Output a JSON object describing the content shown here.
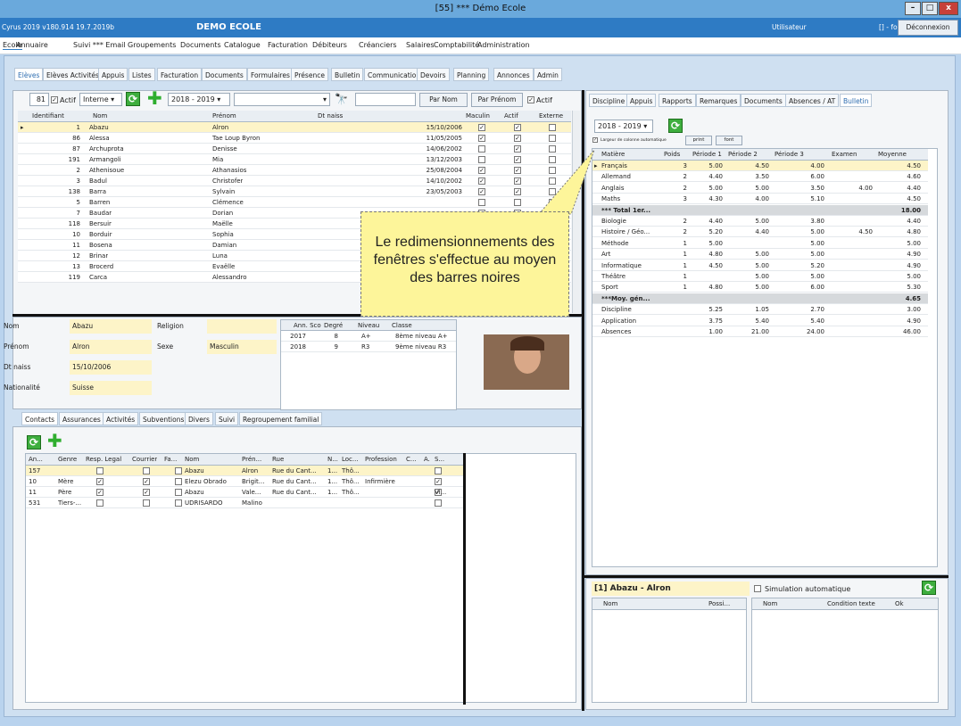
{
  "window": {
    "title": "[55] *** Démo Ecole",
    "min": "–",
    "max": "□",
    "close": "x"
  },
  "appbar": {
    "version": "Cyrus 2019 v180.914 19.7.2019b",
    "school": "DEMO ECOLE",
    "user_label": "Utilisateur",
    "user": "[] - fo",
    "logout": "Déconnexion"
  },
  "menu": [
    "Ecole",
    "Annuaire",
    "Suivi *** Email",
    "Groupements",
    "Documents",
    "Catalogue",
    "Facturation",
    "Débiteurs",
    "Créanciers",
    "Salaires",
    "Comptabilité",
    "Administration"
  ],
  "subtabs": [
    "Elèves",
    "Elèves Activités",
    "Appuis",
    "Listes",
    "Facturation",
    "Documents",
    "Formulaires",
    "Présence",
    "Bulletin",
    "Communication",
    "Devoirs",
    "Planning",
    "Annonces",
    "Admin"
  ],
  "filter": {
    "count": "81",
    "actif_label": "Actif",
    "type": "Interne",
    "year": "2018 - 2019",
    "by_name": "Par Nom",
    "by_firstname": "Par Prénom",
    "actif2": "Actif"
  },
  "students": {
    "columns": [
      "Identifiant",
      "Nom",
      "Prénom",
      "Dt naiss",
      "Maculin",
      "Actif",
      "Externe"
    ],
    "rows": [
      {
        "id": "1",
        "nom": "Abazu",
        "prenom": "Alron",
        "dt": "15/10/2006",
        "m": true,
        "a": true
      },
      {
        "id": "86",
        "nom": "Alessa",
        "prenom": "Tae Loup Byron",
        "dt": "11/05/2005",
        "m": true,
        "a": true
      },
      {
        "id": "87",
        "nom": "Archuprota",
        "prenom": "Denisse",
        "dt": "14/06/2002",
        "m": false,
        "a": true
      },
      {
        "id": "191",
        "nom": "Armangoli",
        "prenom": "Mia",
        "dt": "13/12/2003",
        "m": false,
        "a": true
      },
      {
        "id": "2",
        "nom": "Athenisoue",
        "prenom": "Athanasios",
        "dt": "25/08/2004",
        "m": true,
        "a": true
      },
      {
        "id": "3",
        "nom": "Badul",
        "prenom": "Christofer",
        "dt": "14/10/2002",
        "m": true,
        "a": true
      },
      {
        "id": "138",
        "nom": "Barra",
        "prenom": "Sylvain",
        "dt": "23/05/2003",
        "m": true,
        "a": true
      },
      {
        "id": "5",
        "nom": "Barren",
        "prenom": "Clémence",
        "dt": "",
        "m": false,
        "a": false
      },
      {
        "id": "7",
        "nom": "Baudar",
        "prenom": "Dorian",
        "dt": "",
        "m": false,
        "a": false
      },
      {
        "id": "118",
        "nom": "Bersuir",
        "prenom": "Maëlle",
        "dt": "",
        "m": false,
        "a": false
      },
      {
        "id": "10",
        "nom": "Borduir",
        "prenom": "Sophia",
        "dt": "",
        "m": false,
        "a": false
      },
      {
        "id": "11",
        "nom": "Bosena",
        "prenom": "Damian",
        "dt": "",
        "m": false,
        "a": false
      },
      {
        "id": "12",
        "nom": "Brinar",
        "prenom": "Luna",
        "dt": "",
        "m": false,
        "a": false
      },
      {
        "id": "13",
        "nom": "Brocerd",
        "prenom": "Evaëlle",
        "dt": "",
        "m": false,
        "a": false
      },
      {
        "id": "119",
        "nom": "Carca",
        "prenom": "Alessandro",
        "dt": "",
        "m": false,
        "a": false
      }
    ]
  },
  "detail": {
    "nom_l": "Nom",
    "nom": "Abazu",
    "religion_l": "Religion",
    "prenom_l": "Prénom",
    "prenom": "Alron",
    "sexe_l": "Sexe",
    "sexe": "Masculin",
    "dt_l": "Dt naiss",
    "dt": "15/10/2006",
    "nat_l": "Nationalité",
    "nat": "Suisse"
  },
  "years": {
    "columns": [
      "Ann. Sco",
      "Degré",
      "Niveau",
      "Classe"
    ],
    "rows": [
      [
        "2017",
        "8",
        "A+",
        "8ème niveau A+"
      ],
      [
        "2018",
        "9",
        "R3",
        "9ème niveau R3"
      ]
    ]
  },
  "bottomtabs": [
    "Contacts",
    "Assurances",
    "Activités",
    "Subventions",
    "Divers",
    "Suivi",
    "Regroupement familial"
  ],
  "contacts": {
    "columns": [
      "An...",
      "Genre",
      "Resp. Legal",
      "Courrier",
      "Fa...",
      "Nom",
      "Prén...",
      "Rue",
      "N...",
      "Loc...",
      "Profession",
      "C...",
      "A.",
      "S..."
    ],
    "rows": [
      [
        "157",
        "",
        "",
        "",
        "",
        "Abazu",
        "Alron",
        "Rue du Cant...",
        "1...",
        "Thô...",
        "",
        "",
        "",
        ""
      ],
      [
        "10",
        "Mère",
        "✓",
        "✓",
        "",
        "Elezu Obrado",
        "Brigit...",
        "Rue du Cant...",
        "1...",
        "Thô...",
        "Infirmière",
        "",
        "✓",
        ""
      ],
      [
        "11",
        "Père",
        "✓",
        "✓",
        "",
        "Abazu",
        "Vale...",
        "Rue du Cant...",
        "1...",
        "Thô...",
        "",
        "",
        "✓",
        "Vi..."
      ],
      [
        "531",
        "Tiers-...",
        "",
        "",
        "",
        "UDRISARDO",
        "Malino",
        "",
        "",
        "",
        "",
        "",
        "",
        ""
      ]
    ]
  },
  "righttabs": [
    "Discipline",
    "Appuis",
    "Rapports",
    "Remarques",
    "Documents",
    "Absences / AT",
    "Bulletin"
  ],
  "bulletin": {
    "year": "2018 - 2019",
    "auto_label": "Largeur de colonne automatique",
    "print": "print",
    "font": "font",
    "columns": [
      "Matière",
      "Poids",
      "Période 1",
      "Période 2",
      "Période 3",
      "Examen",
      "Moyenne"
    ],
    "rows": [
      [
        "Français",
        "3",
        "5.00",
        "4.50",
        "4.00",
        "",
        "4.50"
      ],
      [
        "Allemand",
        "2",
        "4.40",
        "3.50",
        "6.00",
        "",
        "4.60"
      ],
      [
        "Anglais",
        "2",
        "5.00",
        "5.00",
        "3.50",
        "4.00",
        "4.40"
      ],
      [
        "Maths",
        "3",
        "4.30",
        "4.00",
        "5.10",
        "",
        "4.50"
      ],
      [
        "*** Total 1er...",
        "",
        "",
        "",
        "",
        "",
        "18.00"
      ],
      [
        "Biologie",
        "2",
        "4.40",
        "5.00",
        "3.80",
        "",
        "4.40"
      ],
      [
        "Histoire / Géo...",
        "2",
        "5.20",
        "4.40",
        "5.00",
        "4.50",
        "4.80"
      ],
      [
        "Méthode",
        "1",
        "5.00",
        "",
        "5.00",
        "",
        "5.00"
      ],
      [
        "Art",
        "1",
        "4.80",
        "5.00",
        "5.00",
        "",
        "4.90"
      ],
      [
        "Informatique",
        "1",
        "4.50",
        "5.00",
        "5.20",
        "",
        "4.90"
      ],
      [
        "Théâtre",
        "1",
        "",
        "5.00",
        "5.00",
        "",
        "5.00"
      ],
      [
        "Sport",
        "1",
        "4.80",
        "5.00",
        "6.00",
        "",
        "5.30"
      ],
      [
        "***Moy. gén...",
        "",
        "",
        "",
        "",
        "",
        "4.65"
      ],
      [
        "Discipline",
        "",
        "5.25",
        "1.05",
        "2.70",
        "",
        "3.00"
      ],
      [
        "Application",
        "",
        "3.75",
        "5.40",
        "5.40",
        "",
        "4.90"
      ],
      [
        "Absences",
        "",
        "1.00",
        "21.00",
        "24.00",
        "",
        "46.00"
      ]
    ]
  },
  "simulation": {
    "student": "[1] Abazu - Alron",
    "sim_label": "Simulation automatique",
    "left_cols": [
      "Nom",
      "Possi..."
    ],
    "right_cols": [
      "Nom",
      "Condition texte",
      "Ok"
    ]
  },
  "callout": "Le redimensionnements des fenêtres s'effectue au moyen des barres noires"
}
